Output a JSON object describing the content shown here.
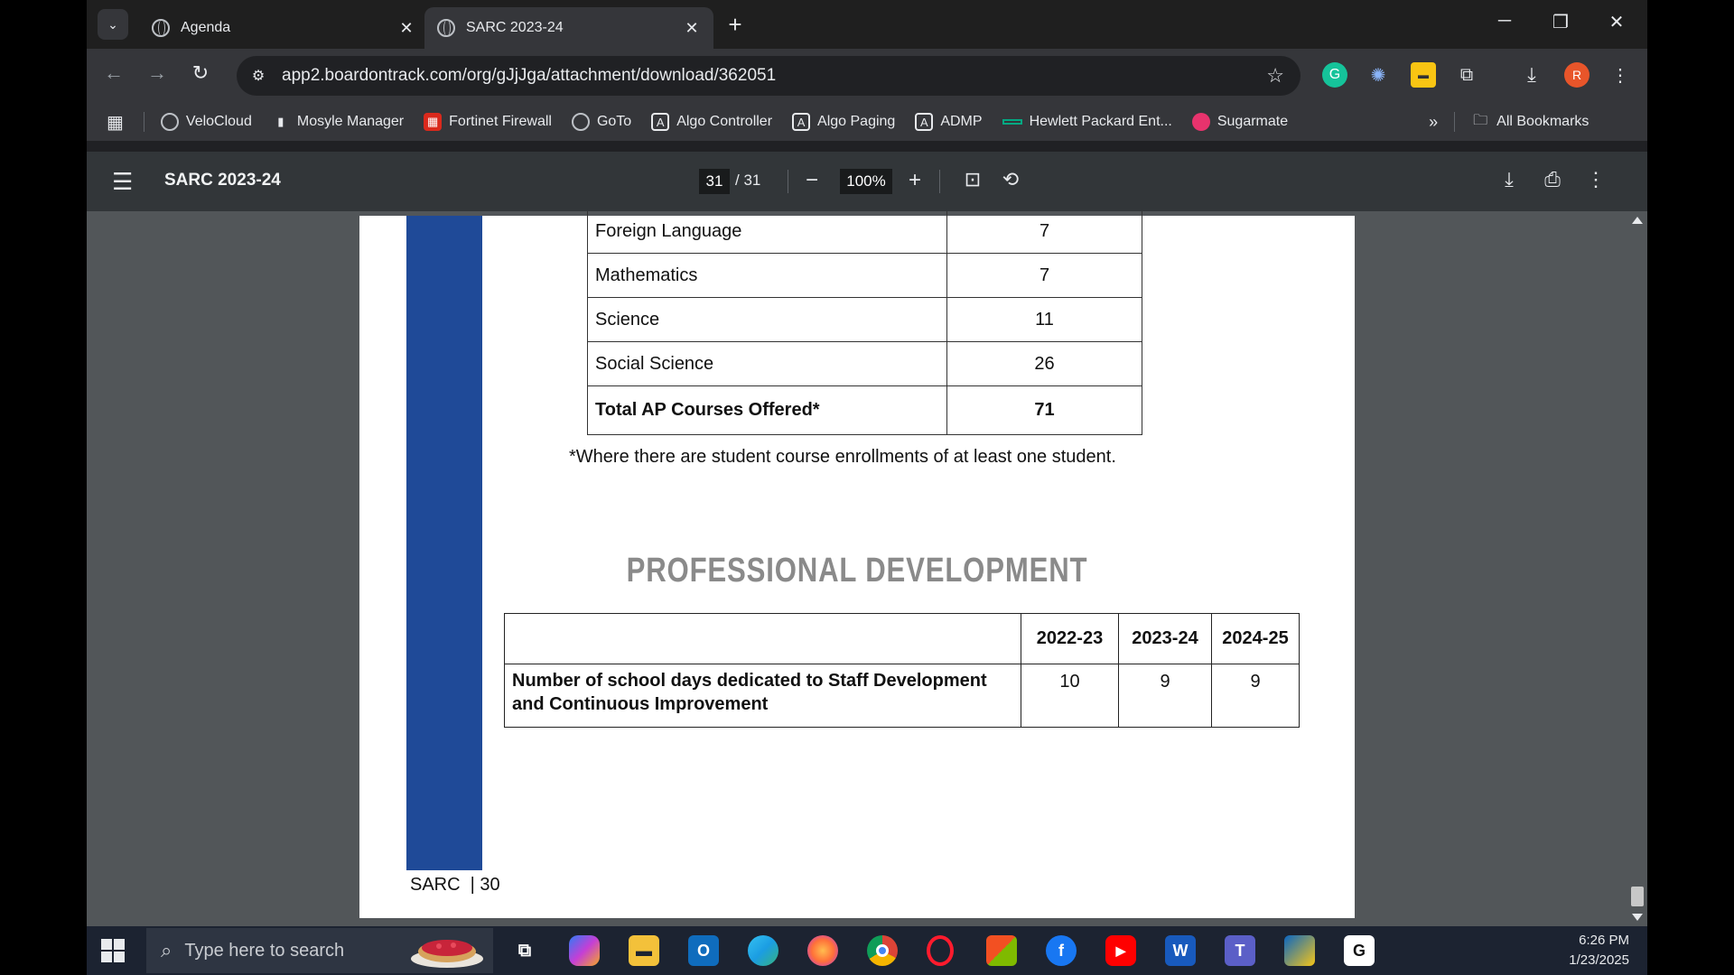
{
  "browser": {
    "tabs": [
      {
        "title": "Agenda"
      },
      {
        "title": "SARC 2023-24"
      }
    ],
    "url": "app2.boardontrack.com/org/gJjJga/attachment/download/362051",
    "profile_initial": "R",
    "bookmarks": [
      {
        "label": "VeloCloud",
        "icon": "globe-icon"
      },
      {
        "label": "Mosyle Manager",
        "icon": "mosyle-icon"
      },
      {
        "label": "Fortinet Firewall",
        "icon": "fortinet-icon"
      },
      {
        "label": "GoTo",
        "icon": "globe-icon"
      },
      {
        "label": "Algo Controller",
        "icon": "algo-icon"
      },
      {
        "label": "Algo Paging",
        "icon": "algo-icon"
      },
      {
        "label": "ADMP",
        "icon": "algo-icon"
      },
      {
        "label": "Hewlett Packard Ent...",
        "icon": "hpe-icon"
      },
      {
        "label": "Sugarmate",
        "icon": "sugarmate-icon"
      }
    ],
    "all_bookmarks": "All Bookmarks"
  },
  "pdf": {
    "title": "SARC 2023-24",
    "page_current": "31",
    "page_total": "/ 31",
    "zoom": "100%"
  },
  "document": {
    "ap_rows": [
      {
        "subject": "Foreign Language",
        "count": "7"
      },
      {
        "subject": "Mathematics",
        "count": "7"
      },
      {
        "subject": "Science",
        "count": "11"
      },
      {
        "subject": "Social Science",
        "count": "26"
      }
    ],
    "ap_total": {
      "label": "Total AP Courses Offered*",
      "count": "71"
    },
    "footnote": "*Where there are student course enrollments of at least one student.",
    "pd_heading": "PROFESSIONAL DEVELOPMENT",
    "pd_table": {
      "headers": [
        "",
        "2022-23",
        "2023-24",
        "2024-25"
      ],
      "row": {
        "label": "Number of school days dedicated to Staff Development and Continuous Improvement",
        "values": [
          "10",
          "9",
          "9"
        ]
      }
    },
    "page_footer": "SARC  | 30"
  },
  "taskbar": {
    "search_placeholder": "Type here to search",
    "time": "6:26 PM",
    "date": "1/23/2025"
  },
  "colors": {
    "accent_blue": "#1f4a98",
    "heading_gray": "#8a8a8a"
  }
}
